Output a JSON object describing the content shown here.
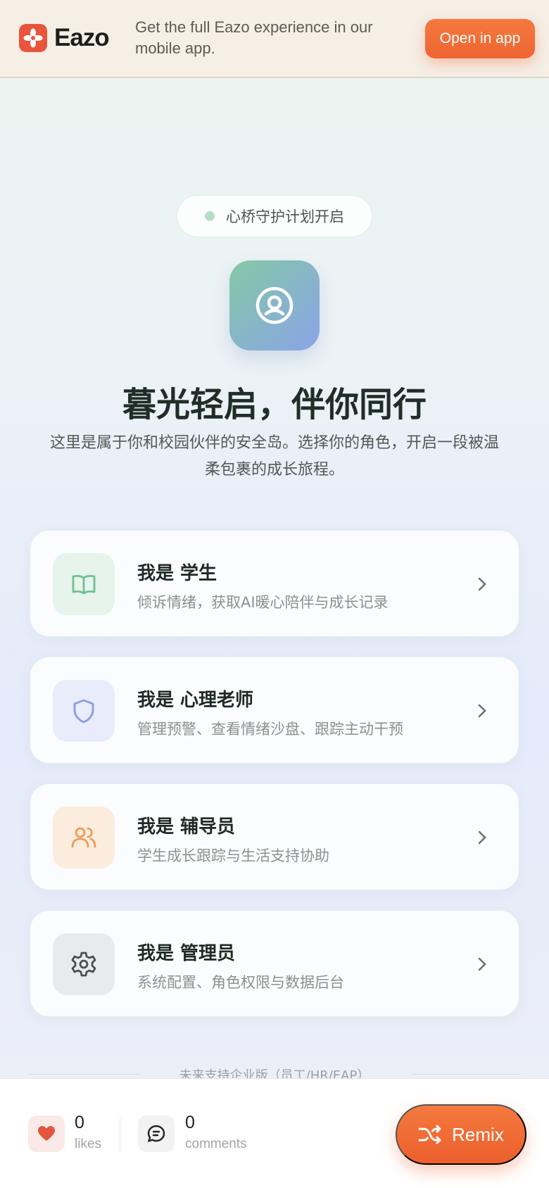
{
  "banner": {
    "brand_name": "Eazo",
    "message": "Get the full Eazo experience in our mobile app.",
    "open_label": "Open in app"
  },
  "hero": {
    "status_pill": "心桥守护计划开启",
    "title": "暮光轻启，伴你同行",
    "subtitle": "这里是属于你和校园伙伴的安全岛。选择你的角色，开启一段被温柔包裹的成长旅程。",
    "icon": "user-shield-icon"
  },
  "roles": [
    {
      "title": "我是 学生",
      "desc": "倾诉情绪，获取AI暖心陪伴与成长记录",
      "icon": "book-open-icon",
      "accent": "#6fbf92",
      "bg": "#e6f4ec"
    },
    {
      "title": "我是 心理老师",
      "desc": "管理预警、查看情绪沙盘、跟踪主动干预",
      "icon": "shield-icon",
      "accent": "#8b9be0",
      "bg": "#e8ecfb"
    },
    {
      "title": "我是 辅导员",
      "desc": "学生成长跟踪与生活支持协助",
      "icon": "users-icon",
      "accent": "#eb9a5a",
      "bg": "#fcecdd"
    },
    {
      "title": "我是 管理员",
      "desc": "系统配置、角色权限与数据后台",
      "icon": "gear-icon",
      "accent": "#4a4f55",
      "bg": "#e9eaec"
    }
  ],
  "footer_note": "未来支持企业版（员工/HR/EAP）",
  "bottom": {
    "likes_count": "0",
    "likes_label": "likes",
    "comments_count": "0",
    "comments_label": "comments",
    "remix_label": "Remix"
  },
  "colors": {
    "brand": "#e8553b",
    "cta": "#f06a33"
  }
}
